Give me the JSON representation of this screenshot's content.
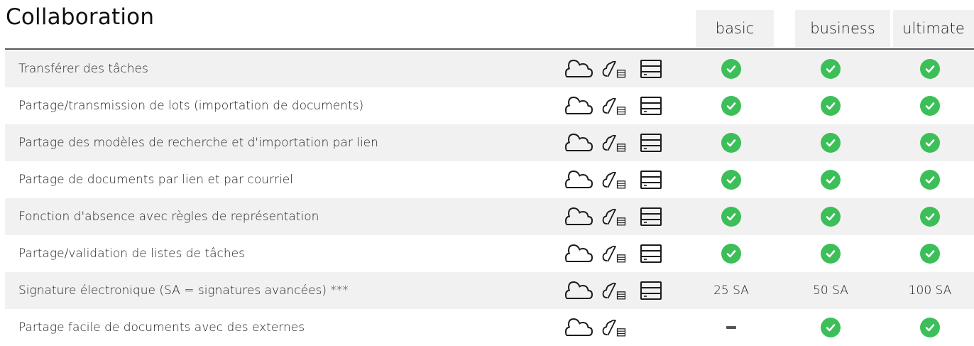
{
  "section": {
    "title": "Collaboration"
  },
  "plans": [
    "basic",
    "business",
    "ultimate"
  ],
  "icons": {
    "cloud": "cloud-icon",
    "hybrid": "hybrid-cloud-server-icon",
    "server": "server-icon",
    "included": "check-circle-icon",
    "not_included": "dash-icon"
  },
  "colors": {
    "check": "#3cbf59",
    "rule": "#555a5f",
    "shade": "#f1f1f1"
  },
  "rows": [
    {
      "feature": "Transférer des tâches",
      "deployment": [
        "cloud",
        "hybrid",
        "server"
      ],
      "values": [
        "check",
        "check",
        "check"
      ]
    },
    {
      "feature": "Partage/transmission de lots (importation de documents)",
      "deployment": [
        "cloud",
        "hybrid",
        "server"
      ],
      "values": [
        "check",
        "check",
        "check"
      ]
    },
    {
      "feature": "Partage des modèles de recherche et d'importation par lien",
      "deployment": [
        "cloud",
        "hybrid",
        "server"
      ],
      "values": [
        "check",
        "check",
        "check"
      ]
    },
    {
      "feature": "Partage de documents par lien et par courriel",
      "deployment": [
        "cloud",
        "hybrid",
        "server"
      ],
      "values": [
        "check",
        "check",
        "check"
      ]
    },
    {
      "feature": "Fonction d'absence avec règles de représentation",
      "deployment": [
        "cloud",
        "hybrid",
        "server"
      ],
      "values": [
        "check",
        "check",
        "check"
      ]
    },
    {
      "feature": "Partage/validation de listes de tâches",
      "deployment": [
        "cloud",
        "hybrid",
        "server"
      ],
      "values": [
        "check",
        "check",
        "check"
      ]
    },
    {
      "feature": "Signature électronique (SA = signatures avancées) ***",
      "deployment": [
        "cloud",
        "hybrid",
        "server"
      ],
      "values": [
        "25 SA",
        "50 SA",
        "100 SA"
      ]
    },
    {
      "feature": "Partage facile de documents avec des externes",
      "deployment": [
        "cloud",
        "hybrid"
      ],
      "values": [
        "dash",
        "check",
        "check"
      ]
    }
  ]
}
